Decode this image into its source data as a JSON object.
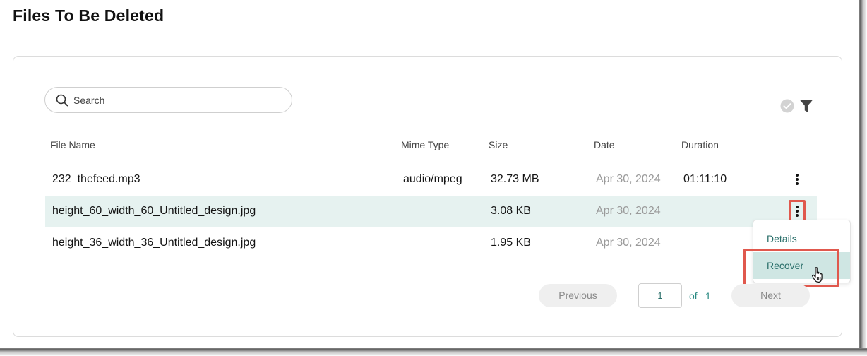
{
  "page": {
    "title": "Files To Be Deleted"
  },
  "search": {
    "placeholder": "Search",
    "value": ""
  },
  "toolbar": {
    "status_icon": "check-circle-icon",
    "filter_icon": "filter-icon"
  },
  "table": {
    "columns": [
      "File Name",
      "Mime Type",
      "Size",
      "Date",
      "Duration"
    ],
    "rows": [
      {
        "file_name": "232_thefeed.mp3",
        "mime_type": "audio/mpeg",
        "size": "32.73 MB",
        "date": "Apr 30, 2024",
        "duration": "01:11:10",
        "selected": false
      },
      {
        "file_name": "height_60_width_60_Untitled_design.jpg",
        "mime_type": "",
        "size": "3.08 KB",
        "date": "Apr 30, 2024",
        "duration": "",
        "selected": true
      },
      {
        "file_name": "height_36_width_36_Untitled_design.jpg",
        "mime_type": "",
        "size": "1.95 KB",
        "date": "Apr 30, 2024",
        "duration": "",
        "selected": false
      }
    ]
  },
  "context_menu": {
    "items": [
      {
        "label": "Details",
        "active": false
      },
      {
        "label": "Recover",
        "active": true
      }
    ]
  },
  "pagination": {
    "previous_label": "Previous",
    "next_label": "Next",
    "current_page": "1",
    "of_label": "of",
    "total_pages": "1"
  },
  "colors": {
    "accent": "#2a6f6a",
    "selected_row": "#e6f2f0",
    "menu_active": "#cfe6e3",
    "highlight_box": "#e0584d"
  }
}
